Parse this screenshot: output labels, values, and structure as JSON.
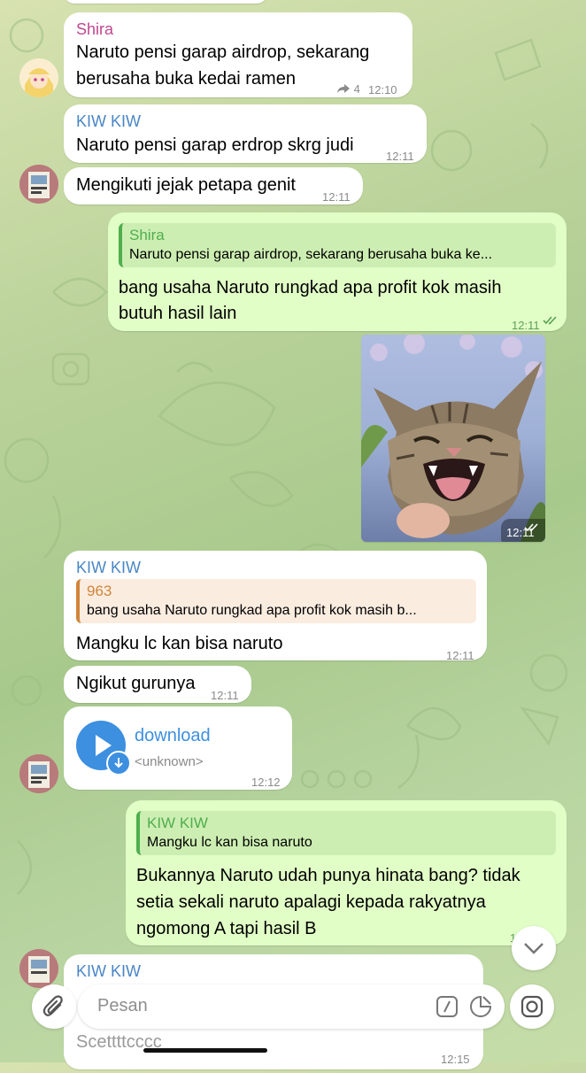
{
  "messages": [
    {
      "sender": "Shira",
      "text_line1": "Naruto pensi garap airdrop, sekarang",
      "text_line2": "berusaha buka kedai ramen",
      "forwards": "4",
      "time": "12:10"
    },
    {
      "sender": "KIW KIW",
      "text": "Naruto pensi garap erdrop skrg judi",
      "time": "12:11"
    },
    {
      "text": "Mengikuti jejak petapa genit",
      "time": "12:11"
    },
    {
      "reply_name": "Shira",
      "reply_text": "Naruto pensi garap airdrop, sekarang berusaha buka ke...",
      "text_line1": "bang usaha Naruto rungkad apa profit kok masih",
      "text_line2": "butuh hasil lain",
      "time": "12:11"
    },
    {
      "image": "laughing-cat-photo",
      "time": "12:11"
    },
    {
      "sender": "KIW KIW",
      "reply_name": "963",
      "reply_text": "bang usaha Naruto rungkad apa profit kok masih b...",
      "text": "Mangku lc kan bisa naruto",
      "time": "12:11"
    },
    {
      "text": "Ngikut gurunya",
      "time": "12:11"
    },
    {
      "file_name": "download",
      "file_meta": "<unknown>",
      "time": "12:12"
    },
    {
      "reply_name": "KIW KIW",
      "reply_text": "Mangku lc kan bisa naruto",
      "text_line1": "Bukannya Naruto udah punya hinata bang? tidak",
      "text_line2": "setia sekali naruto apalagi kepada rakyatnya",
      "text_line3": "ngomong A tapi hasil B",
      "time": "12:1"
    },
    {
      "sender": "KIW KIW",
      "partial_text": "Scettttcccc",
      "time": "12:15"
    }
  ],
  "input": {
    "placeholder": "Pesan"
  },
  "colors": {
    "shira": "#c0478f",
    "kiwkiw": "#4a86c5",
    "963": "#d0853a",
    "reply_green": "#4fae4e",
    "outgoing": "#e1fec6"
  },
  "icons": [
    "attach-icon",
    "command-icon",
    "sticker-icon",
    "camera-icon",
    "scroll-down-icon",
    "play-icon",
    "download-arrow-icon",
    "double-check-icon",
    "forward-icon"
  ]
}
